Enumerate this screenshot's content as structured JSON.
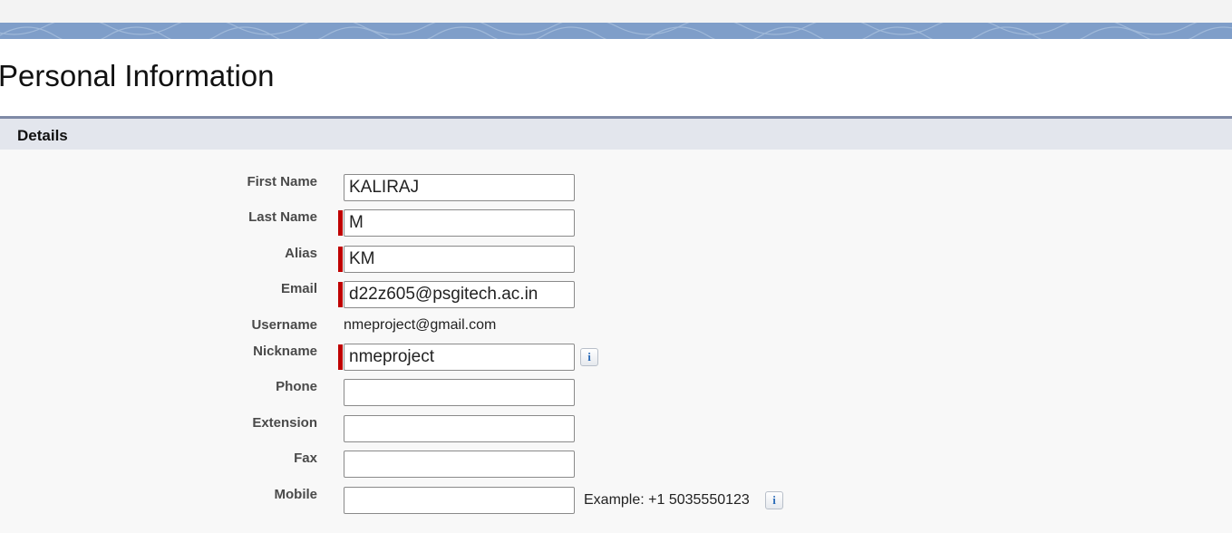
{
  "page": {
    "title": "Personal Information"
  },
  "section": {
    "title": "Details"
  },
  "fields": {
    "first_name": {
      "label": "First Name",
      "value": "KALIRAJ"
    },
    "last_name": {
      "label": "Last Name",
      "value": "M"
    },
    "alias": {
      "label": "Alias",
      "value": "KM"
    },
    "email": {
      "label": "Email",
      "value": "d22z605@psgitech.ac.in"
    },
    "username": {
      "label": "Username",
      "value": "nmeproject@gmail.com"
    },
    "nickname": {
      "label": "Nickname",
      "value": "nmeproject"
    },
    "phone": {
      "label": "Phone",
      "value": ""
    },
    "extension": {
      "label": "Extension",
      "value": ""
    },
    "fax": {
      "label": "Fax",
      "value": ""
    },
    "mobile": {
      "label": "Mobile",
      "value": "",
      "hint": "Example: +1 5035550123"
    }
  },
  "icons": {
    "info": "i"
  },
  "colors": {
    "banner": "#7f9ec9",
    "required_marker": "#c00000",
    "section_header": "#e3e6ed",
    "info_icon": "#2a6bb8"
  }
}
